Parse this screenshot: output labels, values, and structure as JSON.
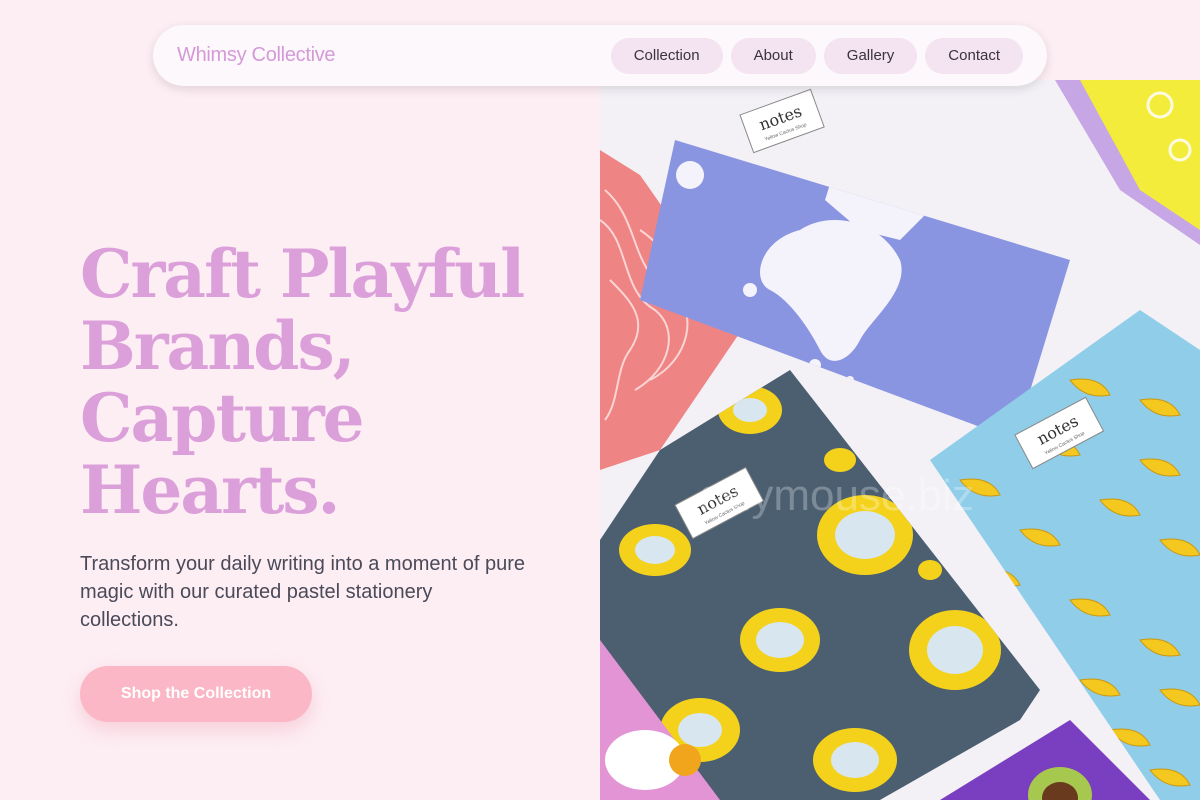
{
  "header": {
    "brand": "Whimsy Collective",
    "nav": [
      "Collection",
      "About",
      "Gallery",
      "Contact"
    ]
  },
  "hero": {
    "headline_lines": [
      "Craft Playful",
      "Brands,",
      "Capture",
      "Hearts."
    ],
    "subtext": "Transform your daily writing into a moment of pure magic with our curated pastel stationery collections.",
    "cta_label": "Shop the Collection"
  },
  "photo": {
    "notebook_label": "notes",
    "notebook_sublabel": "Yellow Cactus Shop",
    "watermark": "sillymouse.biz"
  },
  "colors": {
    "background": "#fdeef4",
    "brand": "#d49ad8",
    "headline": "#dba0da",
    "cta": "#fbb7c6",
    "nav_pill": "#f4e3f1"
  }
}
